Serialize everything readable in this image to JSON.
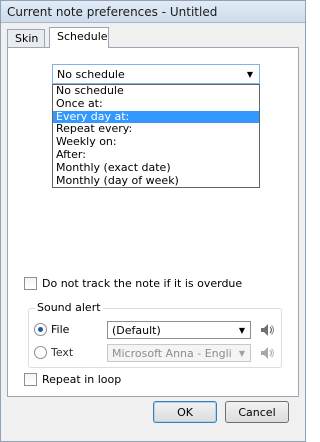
{
  "window": {
    "title": "Current note preferences - Untitled"
  },
  "tabs": [
    {
      "label": "Skin",
      "active": false
    },
    {
      "label": "Schedule",
      "active": true
    }
  ],
  "schedule": {
    "selected_value": "No schedule",
    "options": [
      "No schedule",
      "Once at:",
      "Every day at:",
      "Repeat every:",
      "Weekly on:",
      "After:",
      "Monthly (exact date)",
      "Monthly (day of week)"
    ],
    "highlighted_option": "Every day at:"
  },
  "overdue_checkbox": {
    "label": "Do not track the note if it is overdue",
    "checked": false
  },
  "sound_alert": {
    "title": "Sound alert",
    "file_label": "File",
    "file_checked": true,
    "file_value": "(Default)",
    "text_label": "Text",
    "text_checked": false,
    "text_value": "Microsoft Anna - English (",
    "speaker_icon": "speaker-icon"
  },
  "repeat_checkbox": {
    "label": "Repeat in loop",
    "checked": false
  },
  "buttons": {
    "ok": "OK",
    "cancel": "Cancel"
  },
  "colors": {
    "selection": "#3399ff",
    "focus_border": "#7eb4ea",
    "window_bg": "#f0f0f0"
  }
}
